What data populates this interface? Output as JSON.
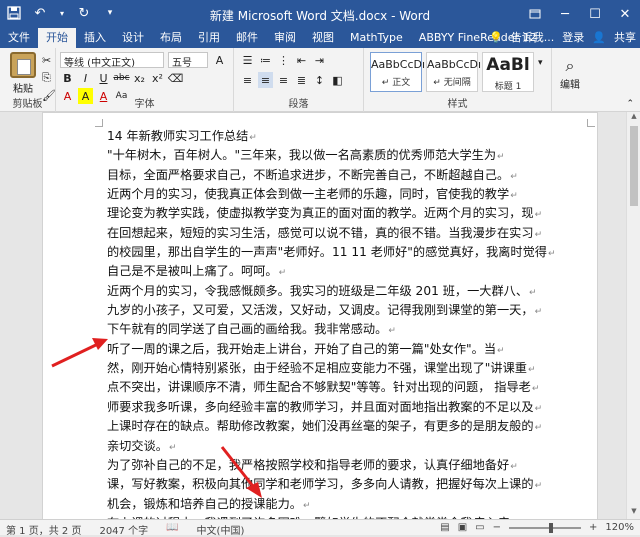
{
  "window": {
    "title": "新建 Microsoft Word 文档.docx - Word",
    "controls": [
      "restore-icon",
      "minimize-icon",
      "maximize-icon",
      "close-icon"
    ]
  },
  "quick_access": {
    "icons": [
      "save-icon",
      "undo-icon",
      "redo-icon",
      "customize-icon"
    ]
  },
  "tabs": [
    "文件",
    "开始",
    "插入",
    "设计",
    "布局",
    "引用",
    "邮件",
    "审阅",
    "视图",
    "MathType",
    "ABBYY FineReader 12"
  ],
  "active_tab": "开始",
  "tell_me": "告诉我...",
  "login": "登录",
  "share": "共享",
  "ribbon": {
    "clipboard": {
      "paste_label": "粘贴",
      "group_label": "剪贴板"
    },
    "font": {
      "font_name": "等线 (中文正文)",
      "font_size": "五号",
      "row2": [
        "B",
        "I",
        "U",
        "abc",
        "x₂",
        "x²"
      ],
      "row3": [
        "A",
        "A",
        "Aa",
        "A"
      ],
      "group_label": "字体"
    },
    "paragraph": {
      "group_label": "段落"
    },
    "styles": {
      "items": [
        {
          "sample": "AaBbCcDı",
          "name": "↵ 正文"
        },
        {
          "sample": "AaBbCcDı",
          "name": "↵ 无间隔"
        },
        {
          "sample": "AaBl",
          "name": "标题 1"
        }
      ],
      "group_label": "样式"
    },
    "editing": {
      "label": "编辑"
    }
  },
  "document": {
    "lines": [
      "14 年新教师实习工作总结",
      "\"十年树木，百年树人。\"三年来，我以做一名高素质的优秀师范大学生为",
      "目标，全面严格要求自己，不断追求进步，不断完善自己，不断超越自己。",
      "近两个月的实习，使我真正体会到做一主老师的乐趣，同时，官使我的教学",
      "理论变为教学实践，使虚拟教学变为真正的面对面的教学。近两个月的实习，现",
      "在回想起来，短短的实习生活，感觉可以说不错，真的很不错。当我漫步在实习",
      "的校园里，那出自学生的一声声\"老师好。11 11 老师好\"的感觉真好，我离时觉得",
      "自己是不是被叫上痛了。呵呵。",
      "近两个月的实习，令我感慨颇多。我实习的班级是二年级 201 班，一大群八、",
      "九岁的小孩子，又可爱，又活泼，又好动，又调皮。记得我刚到课堂的第一天，",
      "下午就有的同学送了自己画的画给我。我非常感动。",
      "听了一周的课之后，我开始走上讲台，开始了自己的第一篇\"处女作\"。当",
      "然，刚开始心情特别紧张，由于经验不足相应变能力不强，课堂出现了\"讲课重",
      "点不突出，讲课顺序不清，师生配合不够默契\"等等。针对出现的问题，  指导老",
      "师要求我多听课，多向经验丰富的教师学习，并且面对面地指出教案的不足以及",
      "上课时存在的缺点。帮助修改教案，她们没再丝毫的架子，有更多的是朋友般的",
      "亲切交谈。",
      "为了弥补自己的不足，我严格按照学校和指导老师的要求，认真仔细地备好",
      "课，写好教案，积极向其他同学和老师学习，多多向人请教，把握好每次上课的",
      "机会，锻炼和培养自己的授课能力。",
      "在上课的过程中，我遇到了许多困难，譬如学生的不配合就常常令我疼心疼"
    ],
    "paragraph_mark": "↵"
  },
  "status": {
    "page": "第 1 页，共 2 页",
    "words": "2047 个字",
    "proof_icon": "proofing-icon",
    "language": "中文(中国)",
    "zoom": "120%"
  },
  "colors": {
    "title_bar": "#2b579a",
    "ribbon_bg": "#f3f3f3",
    "annotation_arrow": "#e02020"
  }
}
